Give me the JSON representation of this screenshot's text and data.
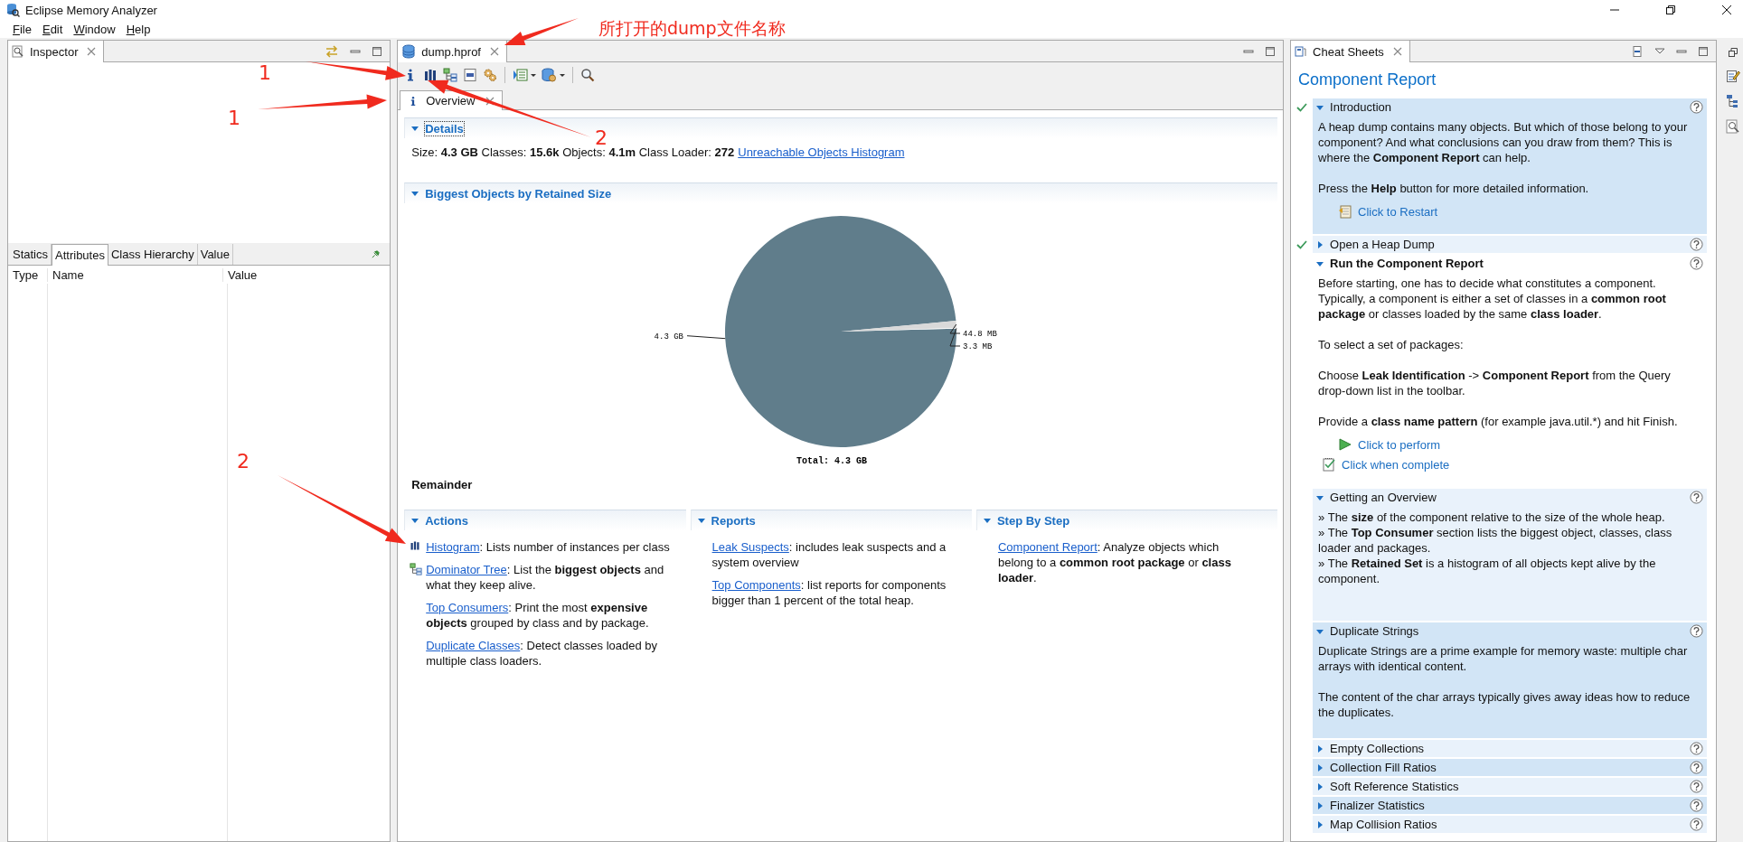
{
  "window": {
    "title": "Eclipse Memory Analyzer"
  },
  "menu": [
    "File",
    "Edit",
    "Window",
    "Help"
  ],
  "inspector": {
    "tab": "Inspector",
    "subtabs": [
      {
        "label": "Statics",
        "selected": false
      },
      {
        "label": "Attributes",
        "selected": true
      },
      {
        "label": "Class Hierarchy",
        "selected": false
      },
      {
        "label": "Value",
        "selected": false
      }
    ],
    "columns": [
      "Type",
      "Name",
      "Value"
    ]
  },
  "editor": {
    "tab": "dump.hprof",
    "subtab": "Overview",
    "details": {
      "title": "Details",
      "text": "Size: **4.3 GB** Classes: **15.6k** Objects: **4.1m** Class Loader: **272**",
      "link": "Unreachable Objects Histogram"
    },
    "biggest": {
      "title": "Biggest Objects by Retained Size",
      "remainder": "Remainder",
      "chart_data": {
        "type": "pie",
        "title": "Total: 4.3 GB",
        "categories": [
          "4.3 GB",
          "44.8 MB",
          "3.3 MB"
        ],
        "values": [
          98.92,
          1.01,
          0.07
        ],
        "colors": [
          "#607d8b",
          "#d9d9d9",
          "#ffffff"
        ]
      }
    },
    "panels": [
      {
        "title": "Actions",
        "items": [
          {
            "kind": "histogram",
            "link": "Histogram",
            "text": ": Lists number of instances per class"
          },
          {
            "kind": "tree",
            "link": "Dominator Tree",
            "text": ": List the **biggest objects** and what they keep alive."
          },
          {
            "kind": "plain",
            "link": "Top Consumers",
            "text": ": Print the most **expensive objects** grouped by class and by package."
          },
          {
            "kind": "plain",
            "link": "Duplicate Classes",
            "text": ": Detect classes loaded by multiple class loaders."
          }
        ]
      },
      {
        "title": "Reports",
        "items": [
          {
            "link": "Leak Suspects",
            "text": ": includes leak suspects and a system overview"
          },
          {
            "link": "Top Components",
            "text": ": list reports for components bigger than 1 percent of the total heap."
          }
        ]
      },
      {
        "title": "Step By Step",
        "items": [
          {
            "link": "Component Report",
            "text": ": Analyze objects which belong to a **common root package** or **class loader**."
          }
        ]
      }
    ]
  },
  "cheatsheet": {
    "tab": "Cheat Sheets",
    "title": "Component Report",
    "sections": [
      {
        "title": "Introduction",
        "completed": true,
        "expanded": true,
        "current": false,
        "paragraphs": [
          "A heap dump contains many objects. But which of those belong to your component? And what conclusions can you draw from them? This is where the **Component Report** can help.",
          "Press the **Help** button for more detailed information."
        ],
        "actions": [
          {
            "kind": "restart",
            "label": "Click to Restart"
          }
        ]
      },
      {
        "title": "Open a Heap Dump",
        "completed": true,
        "expanded": false,
        "current": false
      },
      {
        "title": "Run the Component Report",
        "completed": false,
        "expanded": true,
        "current": true,
        "paragraphs": [
          "Before starting, one has to decide what constitutes a component. Typically, a component is either a set of classes in a **common root package** or classes loaded by the same **class loader**.",
          "To select a set of packages:",
          "Choose **Leak Identification** -> **Component Report** from the Query drop-down list in the toolbar.",
          "Provide a **class name pattern** (for example java.util.*) and hit Finish."
        ],
        "actions": [
          {
            "kind": "perform",
            "label": "Click to perform"
          },
          {
            "kind": "complete",
            "label": "Click when complete"
          }
        ]
      },
      {
        "title": "Getting an Overview",
        "completed": false,
        "expanded": true,
        "current": false,
        "bullets": [
          "» The **size** of the component relative to the size of the whole heap.",
          "» The **Top Consumer** section lists the biggest object, classes, class loader and packages.",
          "» The **Retained Set** is a histogram of all objects kept alive by the component."
        ]
      },
      {
        "title": "Duplicate Strings",
        "completed": false,
        "expanded": true,
        "current": false,
        "paragraphs": [
          "Duplicate Strings are a prime example for memory waste: multiple char arrays with identical content.",
          "The content of the char arrays typically gives away ideas how to reduce the duplicates."
        ]
      },
      {
        "title": "Empty Collections",
        "completed": false,
        "expanded": false,
        "current": false
      },
      {
        "title": "Collection Fill Ratios",
        "completed": false,
        "expanded": false,
        "current": false
      },
      {
        "title": "Soft Reference Statistics",
        "completed": false,
        "expanded": false,
        "current": false
      },
      {
        "title": "Finalizer Statistics",
        "completed": false,
        "expanded": false,
        "current": false
      },
      {
        "title": "Map Collision Ratios",
        "completed": false,
        "expanded": false,
        "current": false
      }
    ]
  },
  "annotations": [
    {
      "text": "所打开的dump文件名称"
    },
    {
      "text": "1"
    },
    {
      "text": "1"
    },
    {
      "text": "2"
    },
    {
      "text": "2"
    }
  ]
}
